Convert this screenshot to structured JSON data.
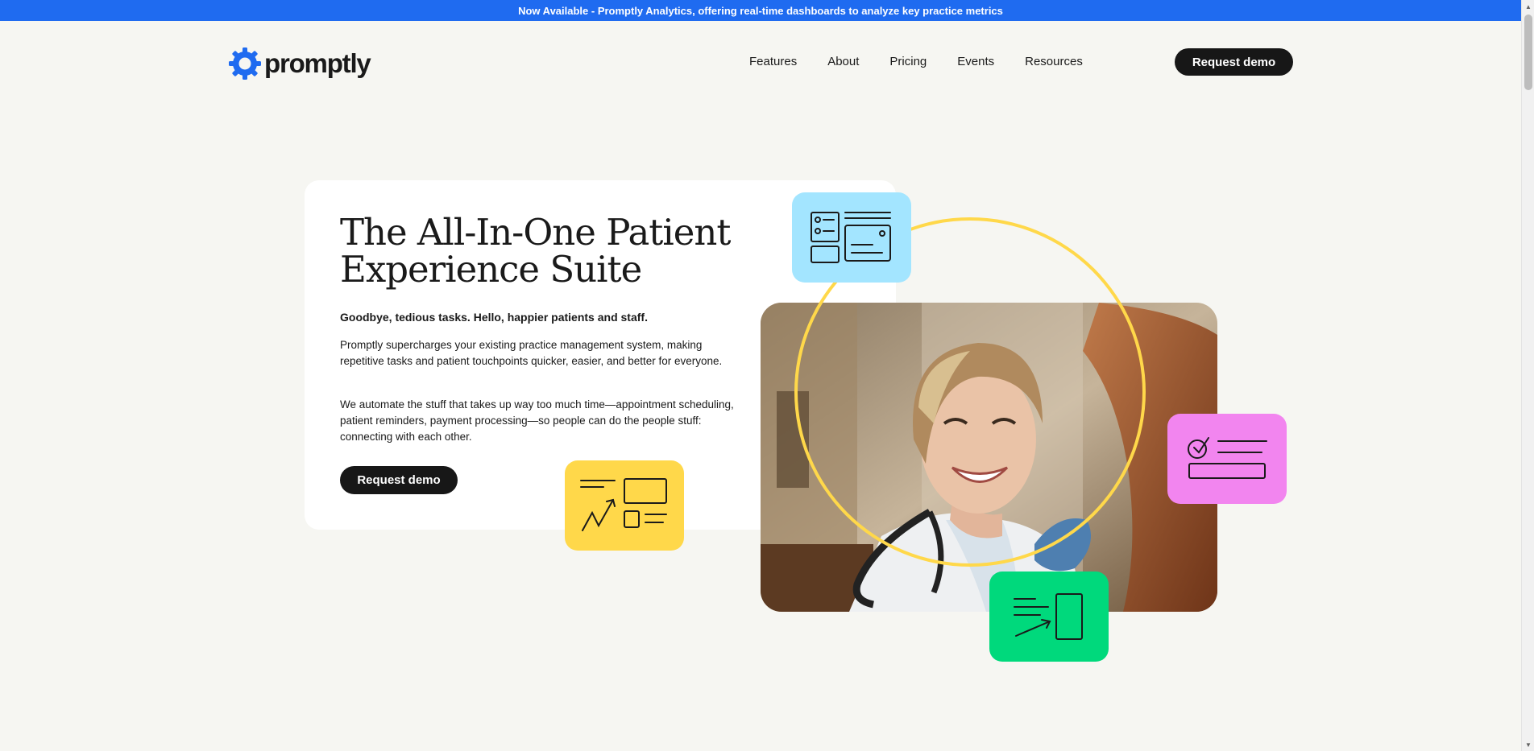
{
  "announcement": {
    "text": "Now Available - Promptly Analytics, offering real-time dashboards to analyze key practice metrics"
  },
  "header": {
    "logo_text": "promptly",
    "logo_icon": "gear-icon",
    "nav": [
      {
        "label": "Features"
      },
      {
        "label": "About"
      },
      {
        "label": "Pricing"
      },
      {
        "label": "Events"
      },
      {
        "label": "Resources"
      }
    ],
    "cta_label": "Request demo"
  },
  "hero": {
    "title": "The All-In-One Patient Experience Suite",
    "subtitle": "Goodbye, tedious tasks. Hello, happier patients and staff.",
    "paragraph1": "Promptly supercharges your existing practice management system, making repetitive tasks and patient touchpoints quicker, easier, and better for everyone.",
    "paragraph2": "We automate the stuff that takes up way too much time—appointment scheduling, patient reminders, payment processing—so people can do the people stuff: connecting with each other.",
    "cta_label": "Request demo"
  },
  "illustrations": {
    "photo": "smiling-doctor-with-stethoscope",
    "tiles": [
      {
        "icon": "dashboard-sketch-icon",
        "color": "#a3e5ff"
      },
      {
        "icon": "growth-chart-sketch-icon",
        "color": "#ffd84a"
      },
      {
        "icon": "checklist-sketch-icon",
        "color": "#f285ef"
      },
      {
        "icon": "document-arrow-sketch-icon",
        "color": "#00d97c"
      }
    ],
    "ring_color": "#ffd84a"
  },
  "colors": {
    "accent": "#1f6bf0",
    "dark_button": "#171717",
    "background": "#f6f6f2"
  }
}
